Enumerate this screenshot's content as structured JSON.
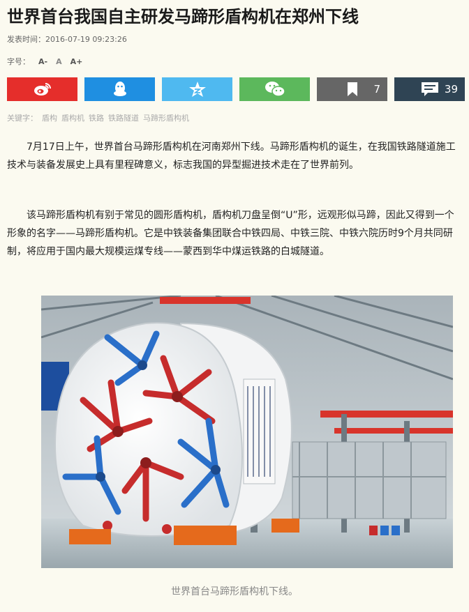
{
  "article": {
    "title": "世界首台我国自主研发马蹄形盾构机在郑州下线",
    "publish_label": "发表时间：",
    "publish_time": "2016-07-19 09:23:26",
    "fontsize_label": "字号：",
    "fontsize_small": "A-",
    "fontsize_normal": "A",
    "fontsize_large": "A+",
    "keywords_label": "关键字：",
    "keywords": [
      "盾构",
      "盾构机",
      "铁路",
      "铁路隧道",
      "马蹄形盾构机"
    ],
    "paragraphs": [
      "7月17日上午，世界首台马蹄形盾构机在河南郑州下线。马蹄形盾构机的诞生，在我国铁路隧道施工技术与装备发展史上具有里程碑意义，标志我国的异型掘进技术走在了世界前列。",
      "该马蹄形盾构机有别于常见的圆形盾构机，盾构机刀盘呈倒“U”形，远观形似马蹄，因此又得到一个形象的名字——马蹄形盾构机。它是中铁装备集团联合中铁四局、中铁三院、中铁六院历时9个月共同研制，将应用于国内最大规模运煤专线——蒙西到华中煤运铁路的白城隧道。"
    ],
    "image_caption": "世界首台马蹄形盾构机下线。"
  },
  "share": {
    "buttons": [
      {
        "name": "weibo",
        "icon": "weibo-icon",
        "color": "#e52e2b"
      },
      {
        "name": "qq",
        "icon": "qq-penguin-icon",
        "color": "#1f8fe1"
      },
      {
        "name": "qzone",
        "icon": "qzone-star-icon",
        "color": "#4fb9f0"
      },
      {
        "name": "wechat",
        "icon": "wechat-icon",
        "color": "#5cb85c"
      },
      {
        "name": "favorite",
        "icon": "bookmark-icon",
        "color": "#666666"
      },
      {
        "name": "comment",
        "icon": "comment-icon",
        "color": "#2f4454"
      }
    ],
    "favorite_count": "7",
    "comment_count": "39"
  }
}
